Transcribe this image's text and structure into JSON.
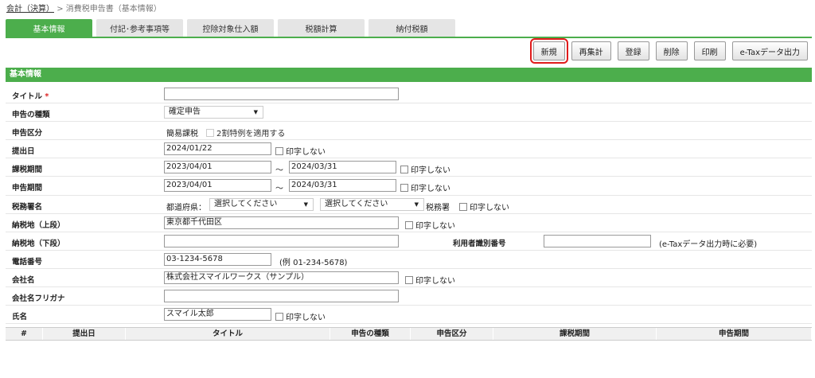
{
  "breadcrumb": {
    "parent": "会計（決算）",
    "separator": ">",
    "current": "消費税申告書（基本情報）"
  },
  "tabs": [
    "基本情報",
    "付記･参考事項等",
    "控除対象仕入額",
    "税額計算",
    "納付税額"
  ],
  "toolbar": {
    "new": "新規",
    "recalc": "再集計",
    "register": "登録",
    "delete": "削除",
    "print": "印刷",
    "etax": "e-Taxデータ出力"
  },
  "section_title": "基本情報",
  "colors": {
    "accent_green": "#4cae4c",
    "highlight_red": "#e01b1b",
    "required": "#d22222"
  },
  "form": {
    "title": {
      "label": "タイトル",
      "required_mark": "*",
      "value": ""
    },
    "type": {
      "label": "申告の種類",
      "value": "確定申告"
    },
    "category": {
      "label": "申告区分",
      "value": "簡易課税",
      "special": "2割特例を適用する"
    },
    "submit_date": {
      "label": "提出日",
      "value": "2024/01/22",
      "no_print": "印字しない"
    },
    "tax_period": {
      "label": "課税期間",
      "from": "2023/04/01",
      "sep": "～",
      "to": "2024/03/31",
      "no_print": "印字しない"
    },
    "report_period": {
      "label": "申告期間",
      "from": "2023/04/01",
      "sep": "～",
      "to": "2024/03/31",
      "no_print": "印字しない"
    },
    "tax_office": {
      "label": "税務署名",
      "pref_label": "都道府県：",
      "pref_value": "選択してください",
      "office_value": "選択してください",
      "suffix": "税務署",
      "no_print": "印字しない"
    },
    "address_upper": {
      "label": "納税地（上段）",
      "value": "東京都千代田区",
      "no_print": "印字しない"
    },
    "address_lower": {
      "label": "納税地（下段）",
      "value": ""
    },
    "user_id": {
      "label": "利用者識別番号",
      "value": "",
      "note": "(e-Taxデータ出力時に必要)"
    },
    "phone": {
      "label": "電話番号",
      "value": "03-1234-5678",
      "example": "(例  01-234-5678)"
    },
    "company": {
      "label": "会社名",
      "value": "株式会社スマイルワークス（サンプル）",
      "no_print": "印字しない"
    },
    "company_kana": {
      "label": "会社名フリガナ",
      "value": ""
    },
    "name": {
      "label": "氏名",
      "value": "スマイル太郎",
      "no_print": "印字しない"
    }
  },
  "table": {
    "headers": [
      "#",
      "提出日",
      "タイトル",
      "申告の種類",
      "申告区分",
      "課税期間",
      "申告期間"
    ]
  }
}
